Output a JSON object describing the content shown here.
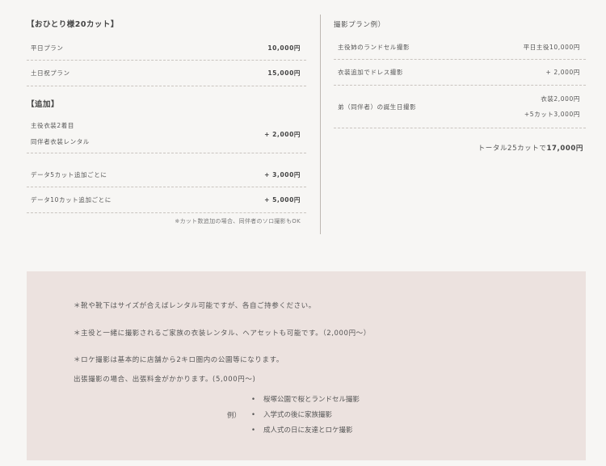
{
  "left": {
    "section1_title": "【おひとり様20カット】",
    "plans": [
      {
        "label": "平日プラン",
        "price": "10,000円"
      },
      {
        "label": "土日祝プラン",
        "price": "15,000円"
      }
    ],
    "section2_title": "【追加】",
    "addons": [
      {
        "line1": "主役衣装2着目",
        "line2": "同伴者衣装レンタル",
        "price": "+ 2,000円"
      },
      {
        "label": "データ5カット追加ごとに",
        "price": "+ 3,000円"
      },
      {
        "label": "データ10カット追加ごとに",
        "price": "+ 5,000円"
      }
    ],
    "note": "※カット数追加の場合、同伴者のソロ撮影もOK"
  },
  "right": {
    "title": "撮影プラン例）",
    "rows": [
      {
        "label": "主役姉のランドセル撮影",
        "price": "平日主役10,000円"
      },
      {
        "label": "衣装追加でドレス撮影",
        "price": "+ 2,000円"
      },
      {
        "label": "弟（同伴者）の誕生日撮影",
        "price_line1": "衣装2,000円",
        "price_line2": "+5カット3,000円"
      }
    ],
    "total_prefix": "トータル25カットで",
    "total_value": "17,000円"
  },
  "info": {
    "line1": "＊靴や靴下はサイズが合えばレンタル可能ですが、各自ご持参ください。",
    "line2": "＊主役と一緒に撮影されるご家族の衣装レンタル、ヘアセットも可能です。（2,000円〜）",
    "line3": "＊ロケ撮影は基本的に店舗から2キロ圏内の公園等になります。",
    "line4": "出張撮影の場合、出張料金がかかります。(5,000円〜)",
    "example_label": "例）",
    "examples": [
      "桜塚公園で桜とランドセル撮影",
      "入学式の後に家族撮影",
      "成人式の日に友達とロケ撮影"
    ]
  }
}
